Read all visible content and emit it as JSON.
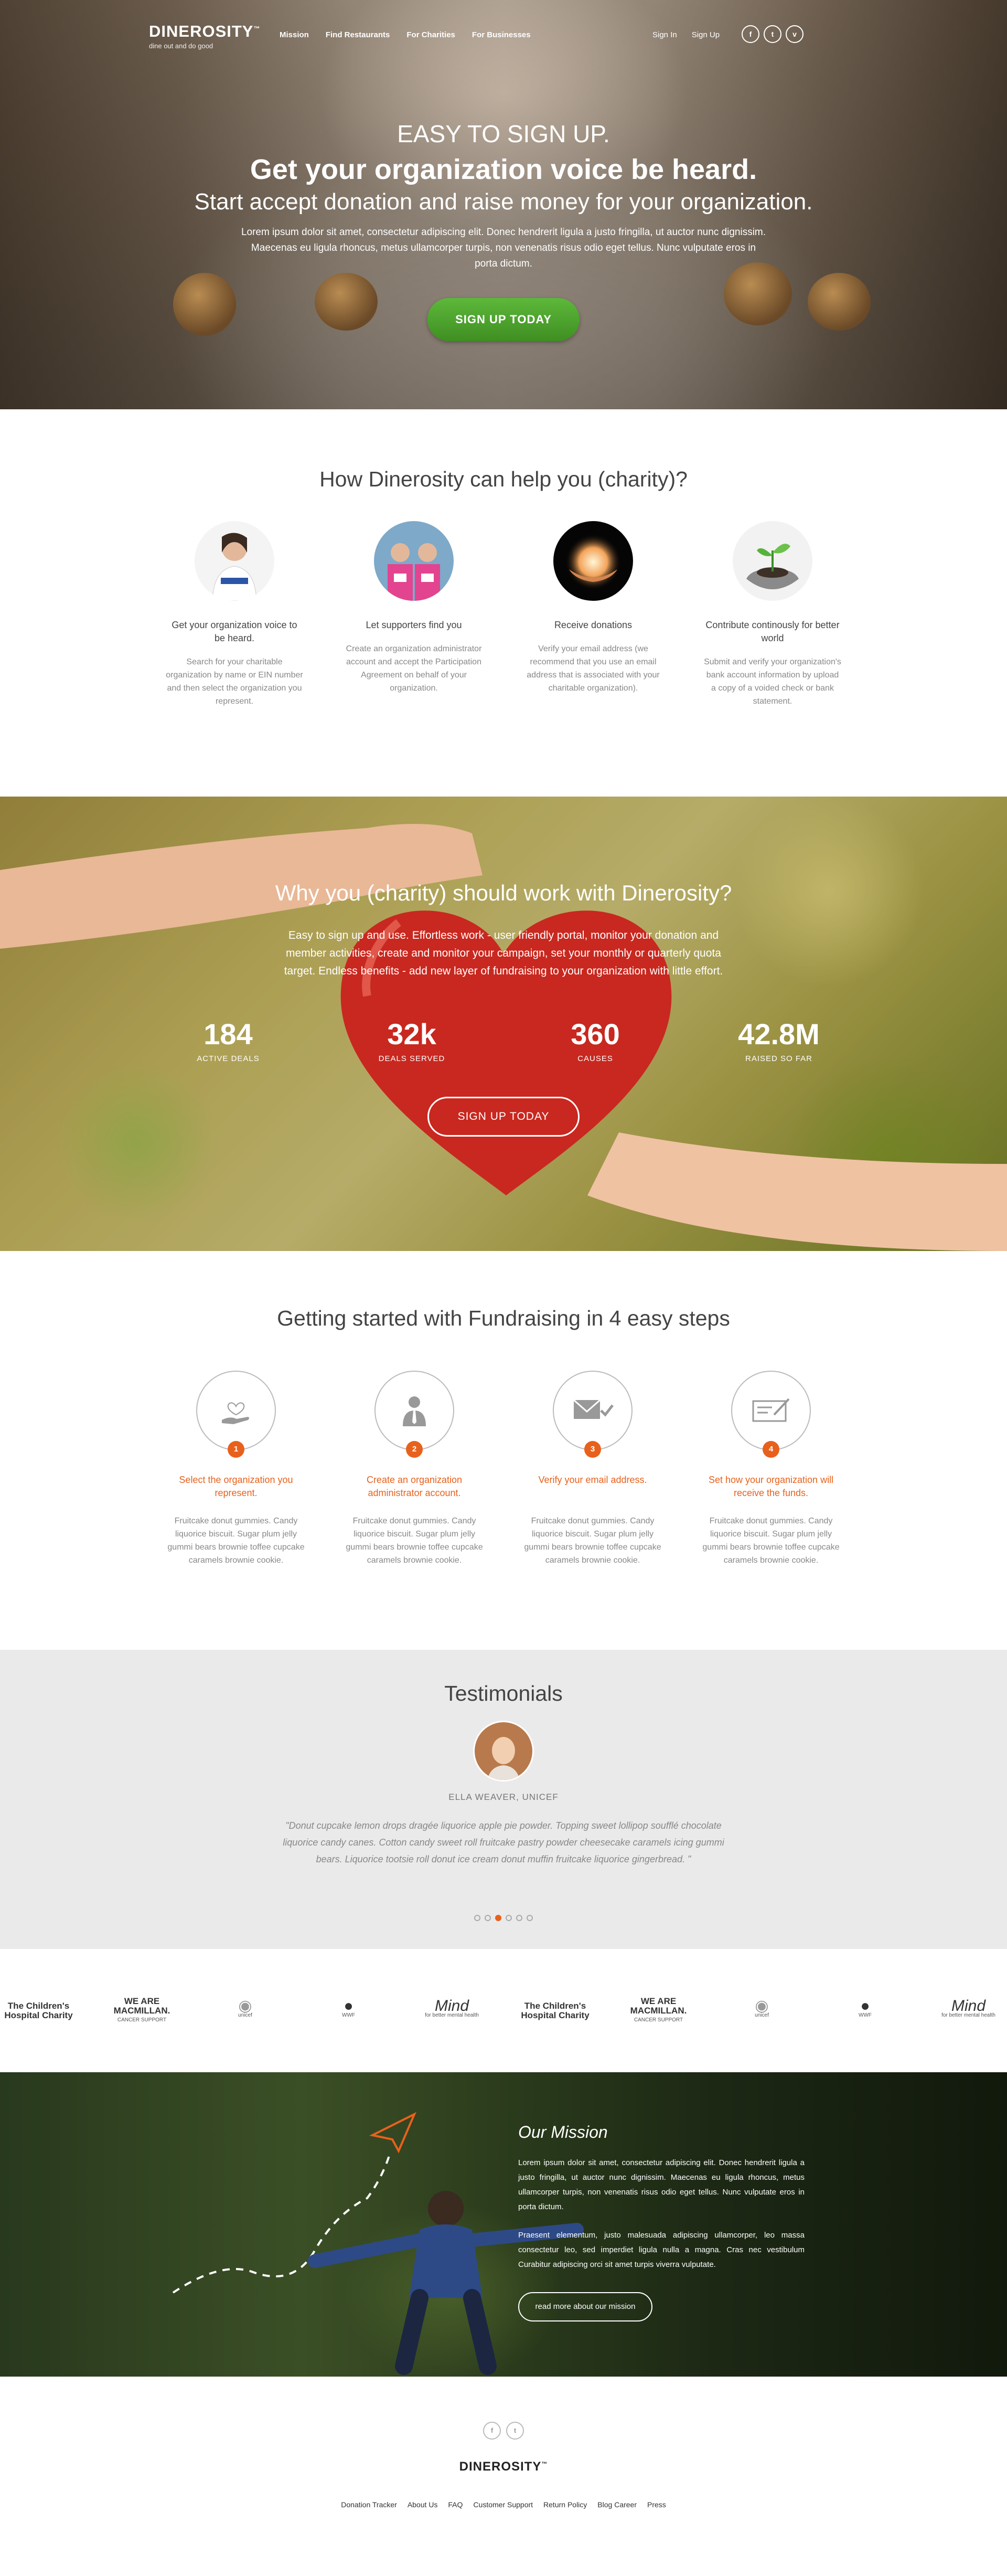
{
  "header": {
    "brand": "DINEROSITY",
    "brand_mark": "™",
    "tagline": "dine out and do good",
    "nav": [
      "Mission",
      "Find Restaurants",
      "For Charities",
      "For Businesses"
    ],
    "auth": [
      "Sign In",
      "Sign Up"
    ],
    "social_icons": [
      "facebook-icon",
      "twitter-icon",
      "vimeo-icon"
    ]
  },
  "hero": {
    "kicker": "EASY TO SIGN UP.",
    "title": "Get your organization voice be heard.",
    "subtitle": "Start accept donation and raise money for your organization.",
    "description": "Lorem ipsum dolor sit amet, consectetur adipiscing elit. Donec hendrerit ligula a justo fringilla, ut auctor nunc dignissim. Maecenas eu ligula rhoncus, metus ullamcorper turpis, non venenatis risus odio eget tellus. Nunc vulputate eros in porta dictum.",
    "cta": "SIGN UP TODAY"
  },
  "how": {
    "title": "How Dinerosity can help you (charity)?",
    "items": [
      {
        "title": "Get your organization voice to be heard.",
        "desc": "Search for your charitable organization by name or EIN number and then select the organization you represent."
      },
      {
        "title": "Let supporters find you",
        "desc": "Create an organization administrator account and accept the  Participation Agreement on behalf of your organization."
      },
      {
        "title": "Receive donations",
        "desc": "Verify your email address (we recommend that you use an email address that is associated with your charitable organization)."
      },
      {
        "title": "Contribute continously for better world",
        "desc": "Submit and verify your organization's bank account information by upload a copy of a voided check or bank statement."
      }
    ]
  },
  "why": {
    "title": "Why you (charity) should work with Dinerosity?",
    "description": "Easy to sign up and use. Effortless work - user friendly portal, monitor your donation and member activities, create and monitor your campaign, set your monthly or quarterly quota target.  Endless benefits - add new layer of fundraising to your organization with little effort.",
    "stats": [
      {
        "value": "184",
        "label": "ACTIVE DEALS"
      },
      {
        "value": "32k",
        "label": "DEALS SERVED"
      },
      {
        "value": "360",
        "label": "CAUSES"
      },
      {
        "value": "42.8M",
        "label": "RAISED SO FAR"
      }
    ],
    "cta": "SIGN UP TODAY"
  },
  "steps": {
    "title": "Getting started with Fundraising in 4 easy steps",
    "items": [
      {
        "num": "1",
        "title": "Select the organization you represent.",
        "desc": "Fruitcake donut gummies. Candy liquorice biscuit. Sugar plum jelly gummi bears brownie toffee cupcake caramels brownie cookie.",
        "icon": "heart-hand-icon"
      },
      {
        "num": "2",
        "title": "Create an organization administrator account.",
        "desc": "Fruitcake donut gummies. Candy liquorice biscuit. Sugar plum jelly gummi bears brownie toffee cupcake caramels brownie cookie.",
        "icon": "admin-user-icon"
      },
      {
        "num": "3",
        "title": "Verify your email address.",
        "desc": "Fruitcake donut gummies. Candy liquorice biscuit. Sugar plum jelly gummi bears brownie toffee cupcake caramels brownie cookie.",
        "icon": "email-check-icon"
      },
      {
        "num": "4",
        "title": "Set how your organization will receive the funds.",
        "desc": "Fruitcake donut gummies. Candy liquorice biscuit. Sugar plum jelly gummi bears brownie toffee cupcake caramels brownie cookie.",
        "icon": "check-document-icon"
      }
    ]
  },
  "testimonials": {
    "title": "Testimonials",
    "name": "ELLA WEAVER, UNICEF",
    "quote": "\"Donut cupcake lemon drops dragée liquorice apple pie powder. Topping sweet lollipop soufflé chocolate liquorice candy canes. Cotton candy sweet roll fruitcake pastry powder cheesecake caramels icing gummi bears. Liquorice tootsie roll donut ice cream donut muffin fruitcake liquorice gingerbread. \"",
    "slide_count": 6,
    "active_slide": 3
  },
  "partners": [
    {
      "name": "The Children's Hospital Charity",
      "l1": "The Children's",
      "l2": "Hospital Charity"
    },
    {
      "name": "We Are Macmillan Cancer Support",
      "l1": "WE ARE MACMILLAN.",
      "l2": "CANCER SUPPORT"
    },
    {
      "name": "unicef",
      "l1": "",
      "l2": "unicef"
    },
    {
      "name": "WWF",
      "l1": "",
      "l2": "WWF"
    },
    {
      "name": "Mind",
      "l1": "Mind",
      "l2": "for better mental health"
    },
    {
      "name": "The Children's Hospital Charity",
      "l1": "The Children's",
      "l2": "Hospital Charity"
    },
    {
      "name": "We Are Macmillan Cancer Support",
      "l1": "WE ARE MACMILLAN.",
      "l2": "CANCER SUPPORT"
    },
    {
      "name": "unicef",
      "l1": "",
      "l2": "unicef"
    },
    {
      "name": "WWF",
      "l1": "",
      "l2": "WWF"
    },
    {
      "name": "Mind",
      "l1": "Mind",
      "l2": "for better mental health"
    }
  ],
  "mission": {
    "title": "Our Mission",
    "p1": "Lorem ipsum dolor sit amet, consectetur adipiscing elit. Donec hendrerit ligula a justo fringilla, ut auctor nunc dignissim. Maecenas eu ligula rhoncus, metus ullamcorper turpis, non venenatis risus odio eget tellus. Nunc vulputate eros in porta dictum.",
    "p2": "Praesent elementum, justo malesuada adipiscing ullamcorper, leo massa consectetur leo, sed imperdiet ligula nulla a magna. Cras nec vestibulum Curabitur adipiscing orci sit amet turpis viverra vulputate.",
    "cta": "read more about our mission"
  },
  "footer": {
    "socials": [
      "f",
      "t"
    ],
    "brand": "DINEROSITY",
    "brand_mark": "™",
    "links": [
      "Donation Tracker",
      "About Us",
      "FAQ",
      "Customer Support",
      "Return Policy",
      "Blog Career",
      "Press"
    ]
  },
  "colors": {
    "accent": "#e8611c",
    "green_button": "#4ea42d",
    "section_gray": "#ebeaea"
  }
}
